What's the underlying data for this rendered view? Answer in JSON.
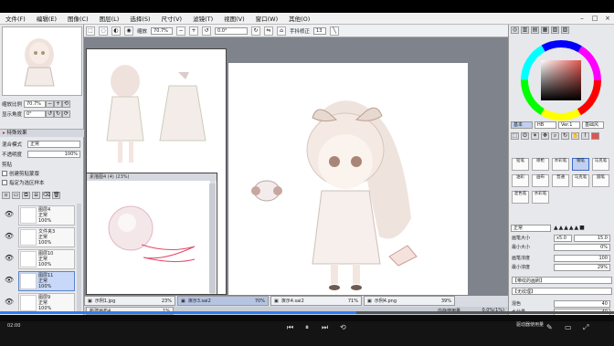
{
  "menu": [
    "文件(F)",
    "编辑(E)",
    "图像(C)",
    "图层(L)",
    "选择(S)",
    "尺寸(V)",
    "滤镜(T)",
    "视图(V)",
    "窗口(W)",
    "其他(O)"
  ],
  "toolbar": {
    "zoom_label": "缩放",
    "zoom_value": "70.7%",
    "angle_value": "0.0°",
    "stabilizer_label": "手抖修正",
    "stabilizer_value": "13"
  },
  "left": {
    "nav_ratio_label": "缩放比例",
    "nav_ratio_value": "70.7%",
    "nav_angle_label": "显示角度",
    "nav_angle_value": "0°",
    "effects_header": "特殊效果",
    "blend_label": "混合模式",
    "blend_value": "正常",
    "opacity_label": "不透明度",
    "opacity_value": "100%",
    "clip_label": "剪贴",
    "clip_opt1": "创建剪贴蒙版",
    "clip_opt2": "指定为选区样本",
    "layers": [
      {
        "name": "图层4",
        "mode": "正常",
        "opacity": "100%"
      },
      {
        "name": "文件夹3",
        "mode": "正常",
        "opacity": "100%"
      },
      {
        "name": "图层10",
        "mode": "正常",
        "opacity": "100%"
      },
      {
        "name": "图层11",
        "mode": "正常",
        "opacity": "100%"
      },
      {
        "name": "图层9",
        "mode": "正常",
        "opacity": "100%"
      }
    ]
  },
  "docs": {
    "small_title": "素描图4 (4) (23%)"
  },
  "tabs": [
    {
      "name": "示例1.jpg",
      "pct": "23%"
    },
    {
      "name": "演示3.sai2",
      "pct": "70%"
    },
    {
      "name": "演示4.sai2",
      "pct": "71%"
    },
    {
      "name": "示例4.png",
      "pct": "39%"
    }
  ],
  "tab2": {
    "name": "新建画布4",
    "pct": "1%"
  },
  "right": {
    "color_tabs": [
      "基本",
      "HB",
      "Ver.1",
      "基础风"
    ],
    "brushes": [
      "铅笔",
      "喷枪",
      "水彩笔",
      "钢笔",
      "马克笔",
      "油彩",
      "画布",
      "普通",
      "马克笔",
      "圆笔",
      "混色笔",
      "水彩笔"
    ],
    "blend_value": "正常",
    "size_label": "画笔大小",
    "size_mult": "x5.0",
    "size_value": "15.0",
    "minsize_label": "最小大小",
    "minsize_value": "0%",
    "density_label": "画笔浓度",
    "density_value": "100",
    "mindensity_label": "最小浓度",
    "mindensity_value": "29%",
    "shape_label": "【带纹的画刷】",
    "texture_label": "【无纹理】",
    "blend2_label": "混色",
    "blend2_value": "40",
    "water_label": "水分量",
    "water_value": "40",
    "keep_label": "色延伸",
    "keep_value": "10"
  },
  "status": {
    "mem_label": "内存使用量",
    "mem_value": "0.0%(1%)",
    "time": "02:00",
    "drive_label": "驱动器使用量"
  },
  "progress_fraction": 0.58,
  "colors": {
    "accent": "#2f7cf0",
    "selected_color": "#e0554f"
  }
}
